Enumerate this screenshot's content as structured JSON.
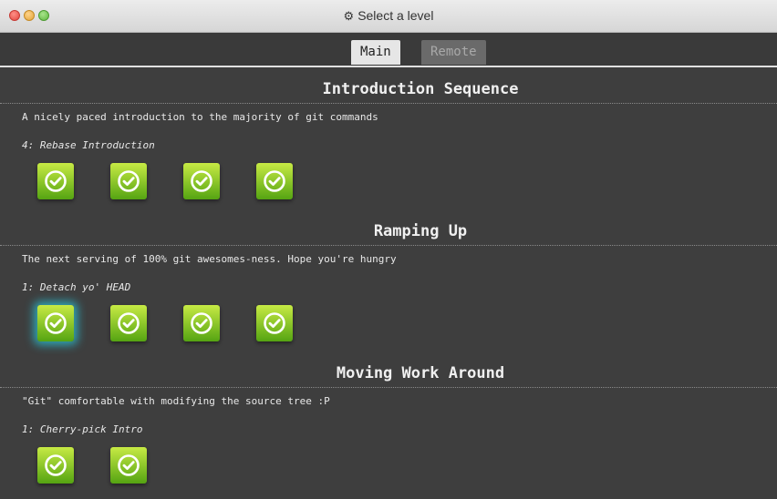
{
  "window": {
    "title": "Select a level",
    "title_icon": "gear-icon"
  },
  "tabs": [
    {
      "label": "Main",
      "active": true
    },
    {
      "label": "Remote",
      "active": false
    }
  ],
  "sequences": [
    {
      "title": "Introduction Sequence",
      "description": "A nicely paced introduction to the majority of git commands",
      "current_level": "4: Rebase Introduction",
      "levels_completed": [
        true,
        true,
        true,
        true
      ]
    },
    {
      "title": "Ramping Up",
      "description": "The next serving of 100% git awesomes-ness. Hope you're hungry",
      "current_level": "1: Detach yo' HEAD",
      "levels_completed": [
        true,
        true,
        true,
        true
      ],
      "selected_level_index": 0
    },
    {
      "title": "Moving Work Around",
      "description": "\"Git\" comfortable with modifying the source tree :P",
      "current_level": "1: Cherry-pick Intro",
      "levels_completed": [
        true,
        true
      ]
    }
  ],
  "colors": {
    "background": "#3e3e3e",
    "level_complete": "#7cc426",
    "selected_glow": "#28c8dc",
    "tab_active": "#e6e6e6",
    "tab_inactive": "#6a6a6a"
  }
}
